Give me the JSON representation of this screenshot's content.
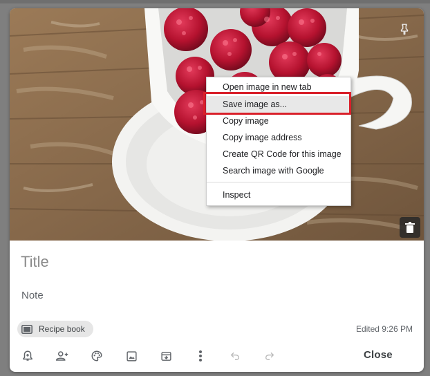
{
  "note": {
    "title_placeholder": "Title",
    "note_placeholder": "Note",
    "label": "Recipe book",
    "edited": "Edited 9:26 PM"
  },
  "toolbar": {
    "icons": [
      "add-alert-icon",
      "collaborator-icon",
      "palette-icon",
      "image-icon",
      "archive-icon",
      "more-vert-icon",
      "undo-icon",
      "redo-icon"
    ],
    "close_label": "Close"
  },
  "context_menu": {
    "items": [
      "Open image in new tab",
      "Save image as...",
      "Copy image",
      "Copy image address",
      "Create QR Code for this image",
      "Search image with Google",
      "Inspect"
    ],
    "highlighted_index": 1
  },
  "colors": {
    "highlight_box": "#d9202a",
    "menu_hover": "#e8e8e8"
  }
}
